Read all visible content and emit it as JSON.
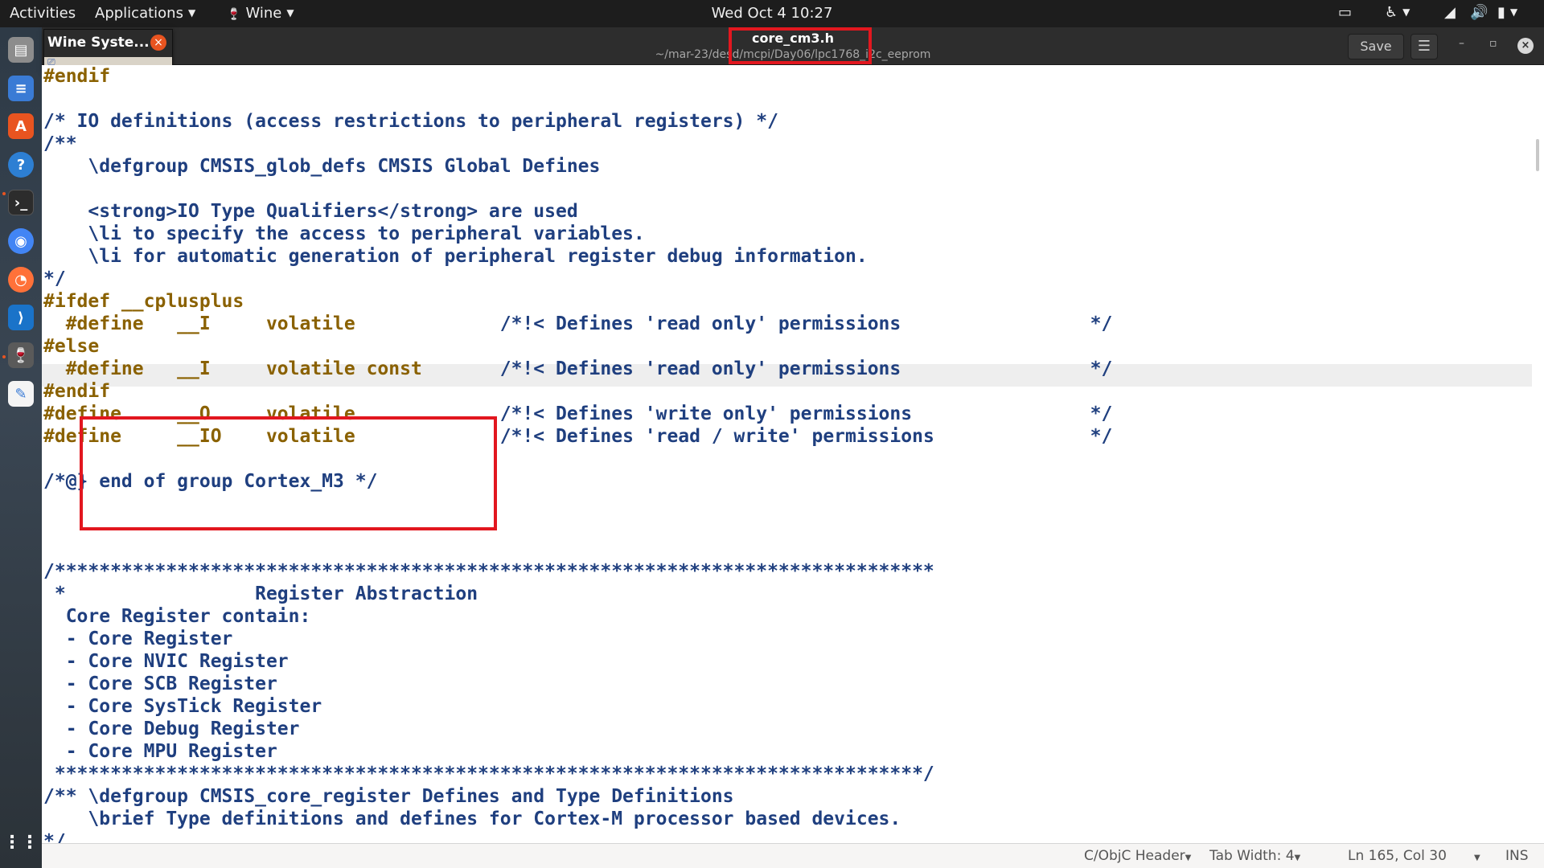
{
  "topbar": {
    "activities": "Activities",
    "applications": "Applications",
    "wine": "Wine",
    "clock": "Wed Oct 4  10:27"
  },
  "header": {
    "title": "core_cm3.h",
    "path": "~/mar-23/desd/mcpi/Day06/lpc1768_i2c_eeprom",
    "save_label": "Save"
  },
  "wine_popup": {
    "title": "Wine Syste..."
  },
  "editor": {
    "lines": [
      {
        "y": 0,
        "segments": [
          {
            "t": "#endif",
            "c": "pre"
          }
        ]
      },
      {
        "y": 1,
        "segments": [
          {
            "t": "",
            "c": "com"
          }
        ]
      },
      {
        "y": 2,
        "segments": [
          {
            "t": "/* IO definitions (access restrictions to peripheral registers) */",
            "c": "com"
          }
        ]
      },
      {
        "y": 3,
        "segments": [
          {
            "t": "/**",
            "c": "com"
          }
        ]
      },
      {
        "y": 4,
        "segments": [
          {
            "t": "    \\defgroup CMSIS_glob_defs CMSIS Global Defines",
            "c": "com"
          }
        ]
      },
      {
        "y": 5,
        "segments": [
          {
            "t": "",
            "c": "com"
          }
        ]
      },
      {
        "y": 6,
        "segments": [
          {
            "t": "    <strong>IO Type Qualifiers</strong> are used",
            "c": "com"
          }
        ]
      },
      {
        "y": 7,
        "segments": [
          {
            "t": "    \\li to specify the access to peripheral variables.",
            "c": "com"
          }
        ]
      },
      {
        "y": 8,
        "segments": [
          {
            "t": "    \\li for automatic generation of peripheral register debug information.",
            "c": "com"
          }
        ]
      },
      {
        "y": 9,
        "segments": [
          {
            "t": "*/",
            "c": "com"
          }
        ]
      },
      {
        "y": 10,
        "segments": [
          {
            "t": "#ifdef __cplusplus",
            "c": "pre"
          }
        ]
      },
      {
        "y": 11,
        "segments": [
          {
            "t": "  #define   __I     volatile",
            "c": "pre"
          },
          {
            "t": "             /*!< Defines 'read only' permissions                 */",
            "c": "com"
          }
        ]
      },
      {
        "y": 12,
        "segments": [
          {
            "t": "#else",
            "c": "pre"
          }
        ]
      },
      {
        "y": 13,
        "segments": [
          {
            "t": "  #define   __I     volatile const",
            "c": "pre"
          },
          {
            "t": "       /*!< Defines 'read only' permissions                 */",
            "c": "com"
          }
        ]
      },
      {
        "y": 14,
        "segments": [
          {
            "t": "#endif",
            "c": "pre"
          }
        ]
      },
      {
        "y": 15,
        "segments": [
          {
            "t": "#define     __O     volatile",
            "c": "pre"
          },
          {
            "t": "             /*!< Defines 'write only' permissions                */",
            "c": "com"
          }
        ]
      },
      {
        "y": 16,
        "segments": [
          {
            "t": "#define     __IO    volatile",
            "c": "pre"
          },
          {
            "t": "             /*!< Defines 'read / write' permissions              */",
            "c": "com"
          }
        ]
      },
      {
        "y": 17,
        "segments": [
          {
            "t": "",
            "c": "com"
          }
        ]
      },
      {
        "y": 18,
        "segments": [
          {
            "t": "/*@} end of group Cortex_M3 */",
            "c": "com"
          }
        ]
      },
      {
        "y": 19,
        "segments": [
          {
            "t": "",
            "c": "com"
          }
        ]
      },
      {
        "y": 20,
        "segments": [
          {
            "t": "",
            "c": "com"
          }
        ]
      },
      {
        "y": 21,
        "segments": [
          {
            "t": "",
            "c": "com"
          }
        ]
      },
      {
        "y": 22,
        "segments": [
          {
            "t": "/*******************************************************************************",
            "c": "com"
          }
        ]
      },
      {
        "y": 23,
        "segments": [
          {
            "t": " *                 Register Abstraction",
            "c": "com"
          }
        ]
      },
      {
        "y": 24,
        "segments": [
          {
            "t": "  Core Register contain:",
            "c": "com"
          }
        ]
      },
      {
        "y": 25,
        "segments": [
          {
            "t": "  - Core Register",
            "c": "com"
          }
        ]
      },
      {
        "y": 26,
        "segments": [
          {
            "t": "  - Core NVIC Register",
            "c": "com"
          }
        ]
      },
      {
        "y": 27,
        "segments": [
          {
            "t": "  - Core SCB Register",
            "c": "com"
          }
        ]
      },
      {
        "y": 28,
        "segments": [
          {
            "t": "  - Core SysTick Register",
            "c": "com"
          }
        ]
      },
      {
        "y": 29,
        "segments": [
          {
            "t": "  - Core Debug Register",
            "c": "com"
          }
        ]
      },
      {
        "y": 30,
        "segments": [
          {
            "t": "  - Core MPU Register",
            "c": "com"
          }
        ]
      },
      {
        "y": 31,
        "segments": [
          {
            "t": " ******************************************************************************/",
            "c": "com"
          }
        ]
      },
      {
        "y": 32,
        "segments": [
          {
            "t": "/** \\defgroup CMSIS_core_register Defines and Type Definitions",
            "c": "com"
          }
        ]
      },
      {
        "y": 33,
        "segments": [
          {
            "t": "    \\brief Type definitions and defines for Cortex-M processor based devices.",
            "c": "com"
          }
        ]
      },
      {
        "y": 34,
        "segments": [
          {
            "t": "*/",
            "c": "com"
          }
        ]
      }
    ]
  },
  "statusbar": {
    "language": "C/ObjC Header",
    "tab_width": "Tab Width: 4",
    "position": "Ln 165, Col 30",
    "mode": "INS"
  },
  "colors": {
    "preprocessor": "#8a6100",
    "comment": "#1f3f7f",
    "highlight_box": "#e2171f",
    "accent": "#e95420"
  },
  "icons": {
    "dock": [
      "files-icon",
      "text-editor-icon",
      "software-store-icon",
      "help-icon",
      "terminal-icon",
      "chrome-icon",
      "firefox-icon",
      "vscode-icon",
      "wine-icon",
      "gedit-icon",
      "show-apps-icon"
    ],
    "tray": [
      "screen-icon",
      "accessibility-icon",
      "wifi-icon",
      "volume-icon",
      "battery-icon"
    ]
  }
}
